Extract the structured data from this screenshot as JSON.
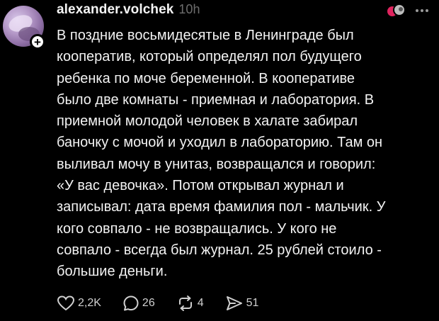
{
  "post": {
    "username": "alexander.volchek",
    "timestamp": "10h",
    "text": "В поздние восьмидесятые в Ленинграде был\nкооператив, который определял пол будущего\nребенка по моче беременной. В кооперативе\nбыло две комнаты - приемная и лаборатория. В\nприемной молодой человек в халате забирал\nбаночку с мочой и уходил в лабораторию. Там он\nвыливал мочу в унитаз, возвращался и говорил:\n«У вас девочка». Потом открывал журнал и\nзаписывал: дата время фамилия пол - мальчик. У\nкого совпало - не возвращались. У кого не\nсовпало - всегда был журнал. 25 рублей стоило -\nбольшие деньги."
  },
  "actions": {
    "likes": "2,2K",
    "replies": "26",
    "reposts": "4",
    "shares": "51"
  },
  "icons": {
    "avatar": "avatar-image",
    "follow": "plus-icon",
    "reaction": "reaction-avatars-icon",
    "more": "more-horizontal-icon",
    "like": "heart-icon",
    "reply": "comment-icon",
    "repost": "repost-icon",
    "share": "send-icon"
  },
  "colors": {
    "background": "#000000",
    "text": "#f3f3f3",
    "muted": "#6d6d6d",
    "icon": "#d0d0d0",
    "reaction_accent": "#e0245e"
  }
}
